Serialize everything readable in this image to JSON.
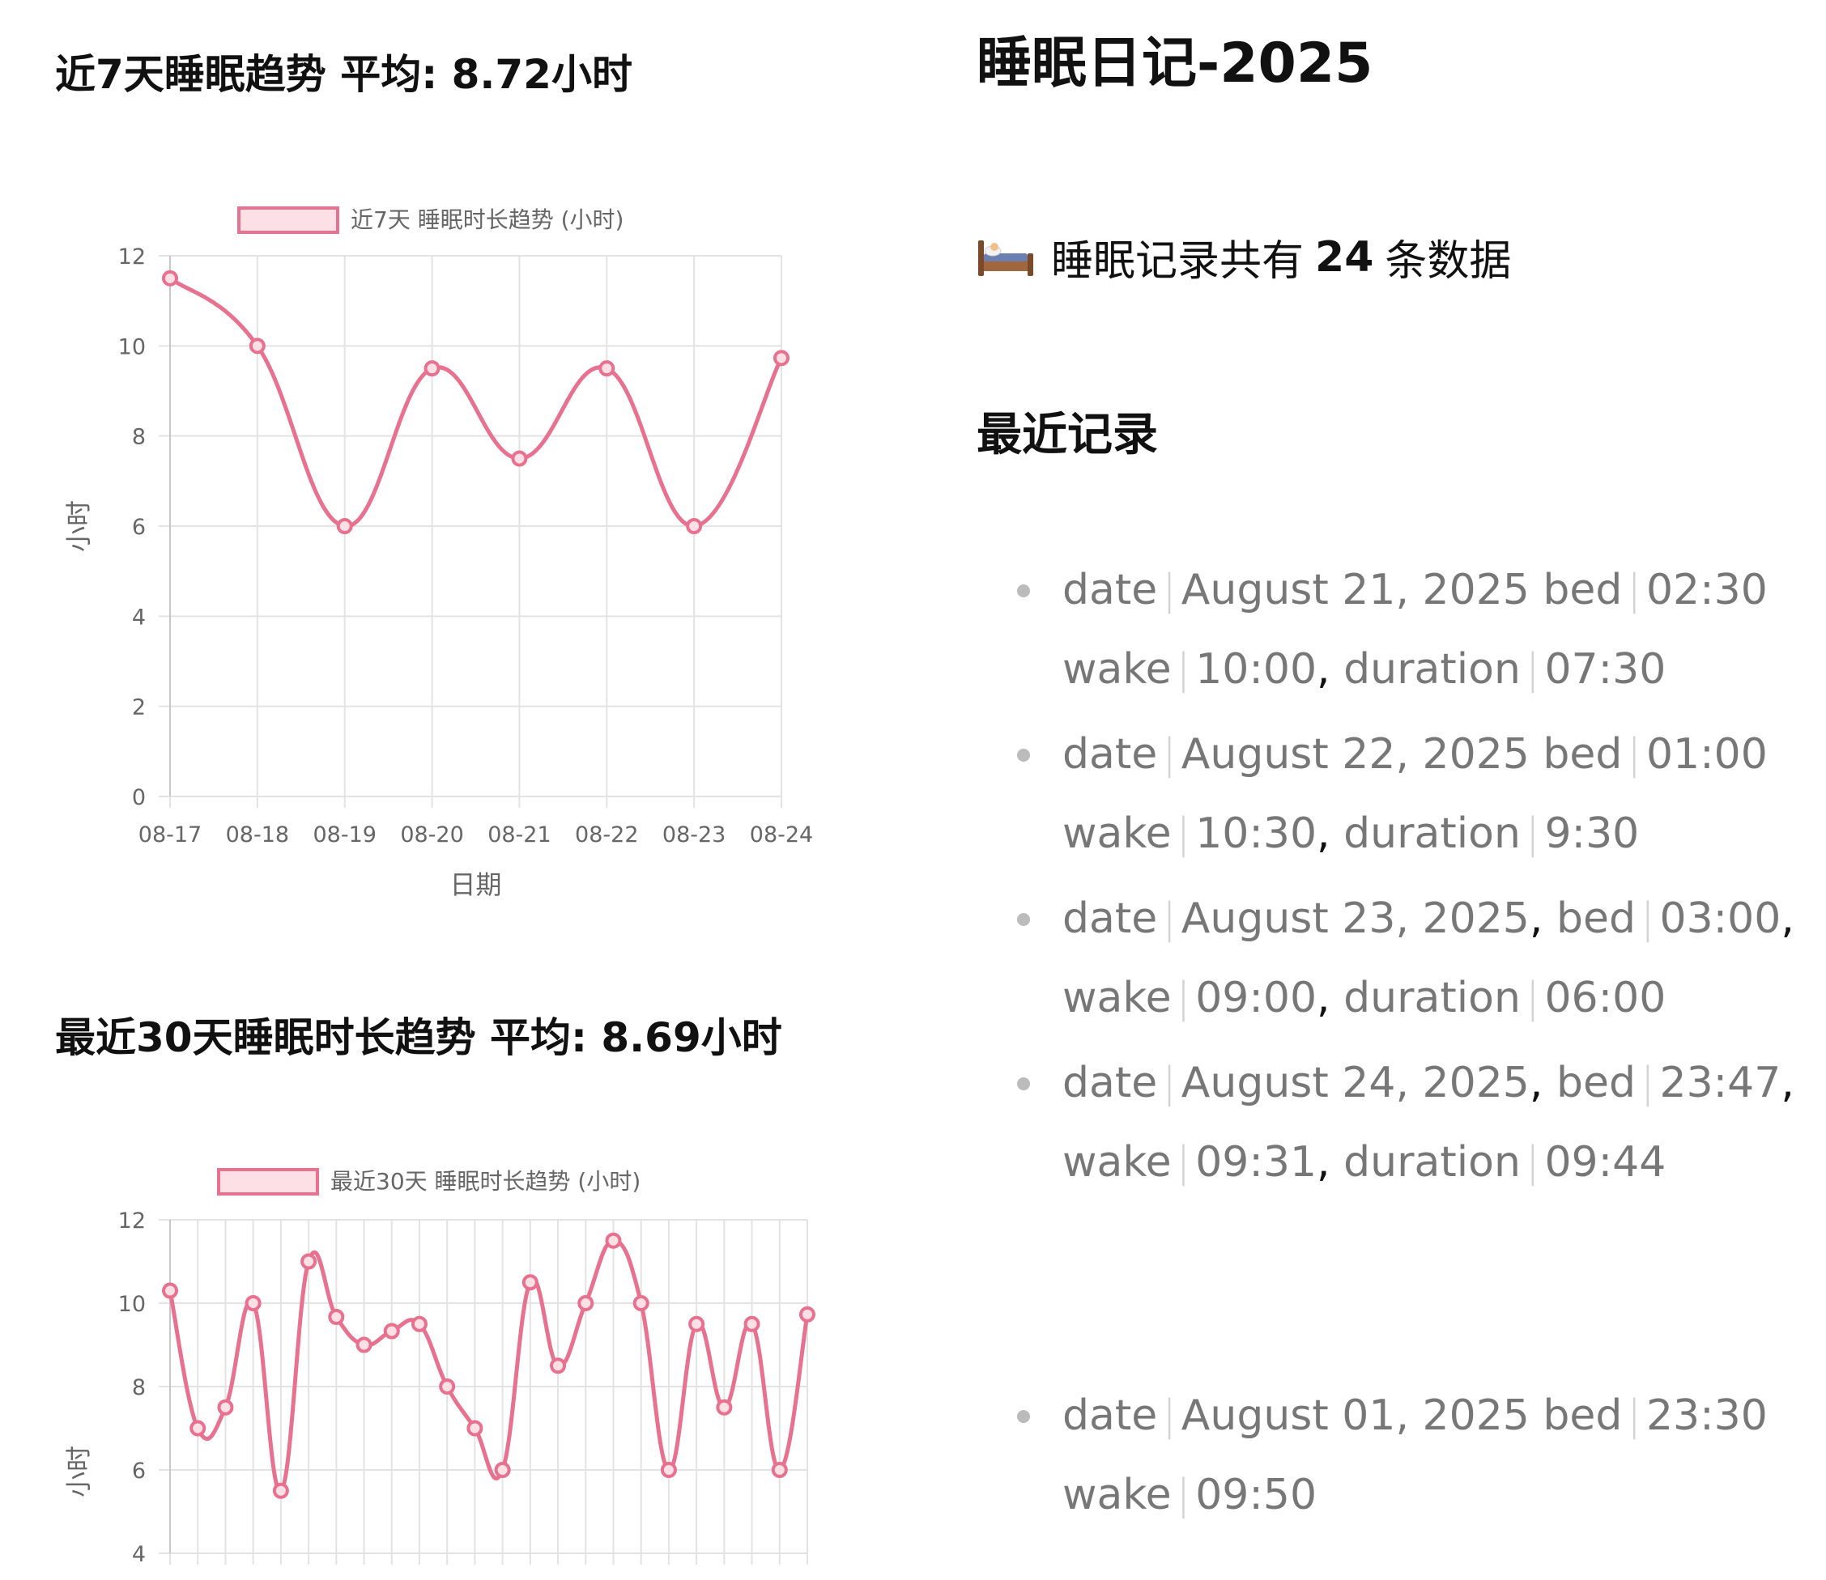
{
  "left": {
    "chart7_title": "近7天睡眠趋势 平均: 8.72小时",
    "chart30_title": "最近30天睡眠时长趋势 平均: 8.69小时"
  },
  "right": {
    "page_title": "睡眠日记-2025",
    "count_prefix": "睡眠记录共有",
    "count_value": "24",
    "count_suffix": "条数据",
    "section_title": "最近记录"
  },
  "records": [
    {
      "date_label": "date",
      "date": "August 21, 2025",
      "bed_label": "bed",
      "bed": "02:30",
      "bed_comma": "",
      "wake_label": "wake",
      "wake": "10:00",
      "duration_label": "duration",
      "duration": "07:30"
    },
    {
      "date_label": "date",
      "date": "August 22, 2025",
      "bed_label": "bed",
      "bed": "01:00",
      "bed_comma": "",
      "wake_label": "wake",
      "wake": "10:30",
      "duration_label": "duration",
      "duration": "9:30"
    },
    {
      "date_label": "date",
      "date": "August 23, 2025",
      "bed_label": "bed",
      "bed": "03:00",
      "bed_comma": ",",
      "wake_label": "wake",
      "wake": "09:00",
      "duration_label": "duration",
      "duration": "06:00"
    },
    {
      "date_label": "date",
      "date": "August 24, 2025",
      "bed_label": "bed",
      "bed": "23:47",
      "bed_comma": ",",
      "wake_label": "wake",
      "wake": "09:31",
      "duration_label": "duration",
      "duration": "09:44"
    },
    {
      "date_label": "date",
      "date": "August 01, 2025",
      "bed_label": "bed",
      "bed": "23:30",
      "bed_comma": "",
      "wake_label": "wake",
      "wake": "09:50",
      "duration_label": "",
      "duration": ""
    }
  ],
  "chart_data": [
    {
      "type": "line",
      "legend": "近7天 睡眠时长趋势 (小时)",
      "xlabel": "日期",
      "ylabel": "小时",
      "categories": [
        "08-17",
        "08-18",
        "08-19",
        "08-20",
        "08-21",
        "08-22",
        "08-23",
        "08-24"
      ],
      "values": [
        11.5,
        10,
        6,
        9.5,
        7.5,
        9.5,
        6,
        9.73
      ],
      "ylim": [
        0,
        12
      ],
      "yticks": [
        0,
        2,
        4,
        6,
        8,
        10,
        12
      ],
      "grid": true,
      "legend_position": "top",
      "color": "#e8718f",
      "fill": "#fde0e6"
    },
    {
      "type": "line",
      "legend": "最近30天 睡眠时长趋势 (小时)",
      "ylabel": "小时",
      "values": [
        10.3,
        7,
        7.5,
        10,
        5.5,
        11,
        9.67,
        9,
        9.33,
        9.5,
        8,
        7,
        6,
        10.5,
        8.5,
        10,
        11.5,
        10,
        6,
        9.5,
        7.5,
        9.5,
        6,
        9.73
      ],
      "ylim": [
        4,
        12
      ],
      "yticks": [
        4,
        6,
        8,
        10,
        12
      ],
      "grid": true,
      "legend_position": "top",
      "color": "#e8718f",
      "fill": "#fde0e6"
    }
  ]
}
